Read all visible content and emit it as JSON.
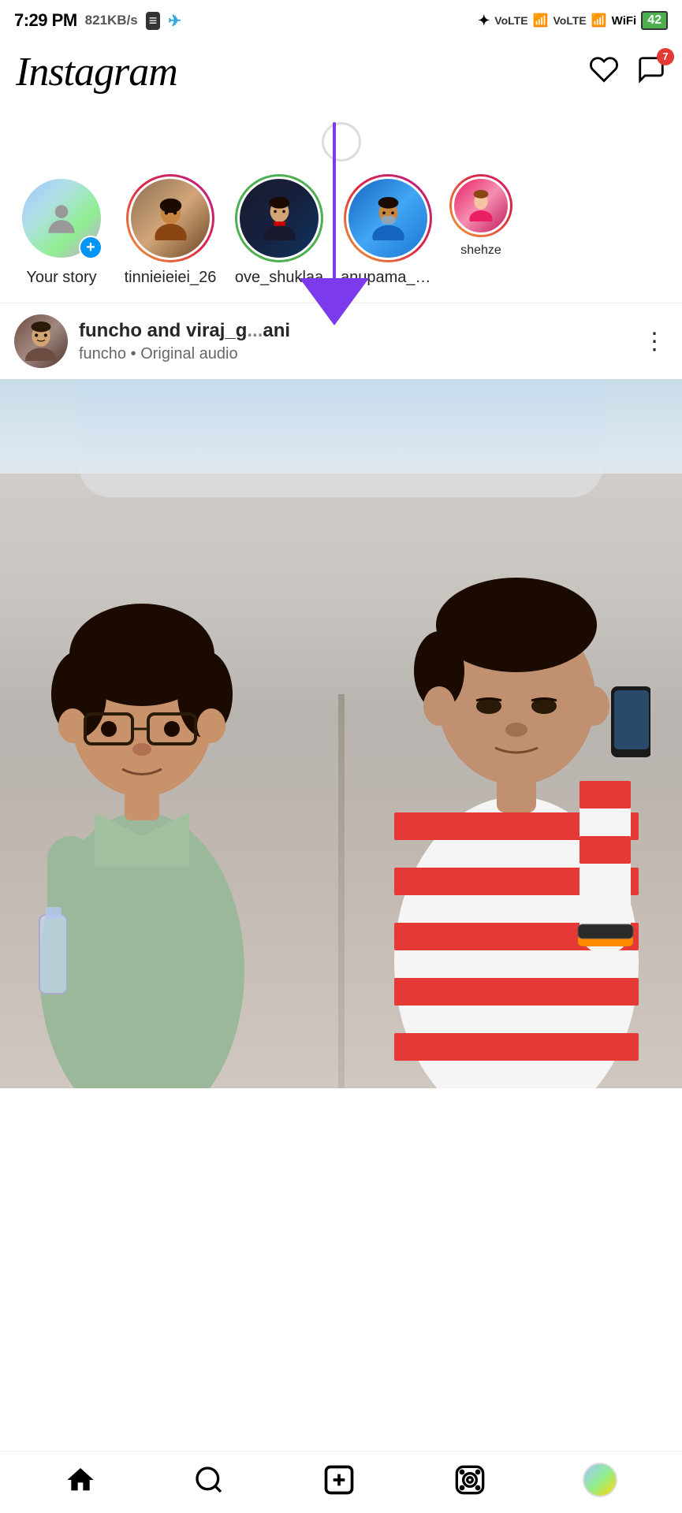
{
  "statusBar": {
    "time": "7:29 PM",
    "network": "821KB/s",
    "battery": "42"
  },
  "header": {
    "title": "Instagram",
    "heartLabel": "♡",
    "messengerLabel": "💬",
    "messageBadge": "7"
  },
  "stories": [
    {
      "id": "your-story",
      "label": "Your story",
      "ring": "none",
      "hasAdd": true
    },
    {
      "id": "tinnieieiei_26",
      "label": "tinnieieiei_26",
      "ring": "gradient",
      "hasAdd": false
    },
    {
      "id": "ove_shuklaa",
      "label": "ove_shuklaa",
      "ring": "green",
      "hasAdd": false
    },
    {
      "id": "anupama_vi",
      "label": "anupama_vi...",
      "ring": "gradient",
      "hasAdd": false
    },
    {
      "id": "shehze",
      "label": "shehze",
      "ring": "red",
      "hasAdd": false
    }
  ],
  "reel": {
    "user1": "funcho",
    "user2": "viraj_g",
    "user2suffix": "ani",
    "subtext": "funcho",
    "audio": "Original audio",
    "dotsLabel": "⋮"
  },
  "bottomNav": {
    "home": "⌂",
    "search": "🔍",
    "add": "⊕",
    "reels": "▶",
    "profile": ""
  }
}
